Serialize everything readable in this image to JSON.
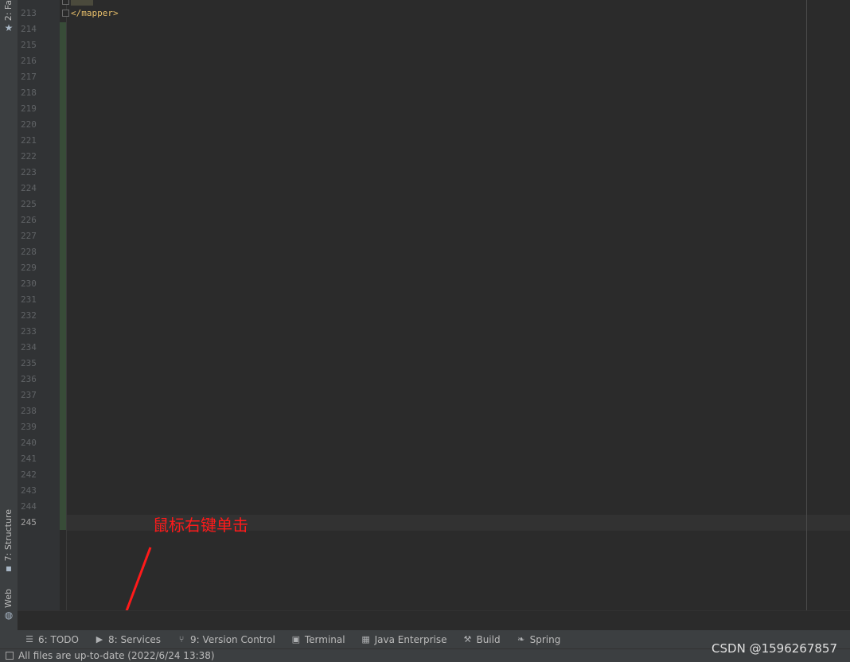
{
  "left_tabs": {
    "favorites": {
      "label": "2: Fa",
      "icon": "star-icon"
    },
    "structure": {
      "label": "7: Structure",
      "icon": "structure-icon"
    },
    "web": {
      "label": "Web",
      "icon": "globe-icon"
    }
  },
  "gutter": {
    "line_numbers": [
      "213",
      "214",
      "215",
      "216",
      "217",
      "218",
      "219",
      "220",
      "221",
      "222",
      "223",
      "224",
      "225",
      "226",
      "227",
      "228",
      "229",
      "230",
      "231",
      "232",
      "233",
      "234",
      "235",
      "236",
      "237",
      "238",
      "239",
      "240",
      "241",
      "242",
      "243",
      "244",
      "245"
    ],
    "current_line": "245"
  },
  "editor": {
    "code_line_213": "</mapper>"
  },
  "annotation": {
    "text": "鼠标右键单击",
    "color": "#ff1a1a"
  },
  "tool_windows": [
    {
      "label": "6: TODO",
      "icon": "list-icon"
    },
    {
      "label": "8: Services",
      "icon": "play-circle-icon"
    },
    {
      "label": "9: Version Control",
      "icon": "vcs-branch-icon"
    },
    {
      "label": "Terminal",
      "icon": "terminal-icon"
    },
    {
      "label": "Java Enterprise",
      "icon": "java-enterprise-icon"
    },
    {
      "label": "Build",
      "icon": "hammer-icon"
    },
    {
      "label": "Spring",
      "icon": "spring-leaf-icon"
    }
  ],
  "status": {
    "message": "All files are up-to-date (2022/6/24 13:38)"
  },
  "watermark": "CSDN @1596267857"
}
